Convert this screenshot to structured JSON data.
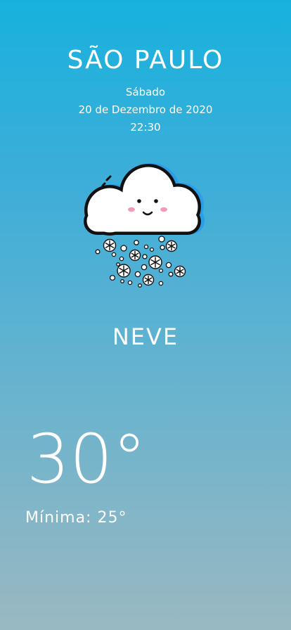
{
  "location": {
    "city": "SÃO PAULO"
  },
  "datetime": {
    "weekday": "Sábado",
    "date": "20 de Dezembro de 2020",
    "time": "22:30"
  },
  "weather": {
    "icon": "snow-cloud-icon",
    "condition": "NEVE",
    "temperature": "30°",
    "minimum_label": "Mínima: 25°"
  },
  "colors": {
    "background_top": "#18b1de",
    "background_bottom": "#9ab8c1",
    "text": "#ffffff"
  }
}
